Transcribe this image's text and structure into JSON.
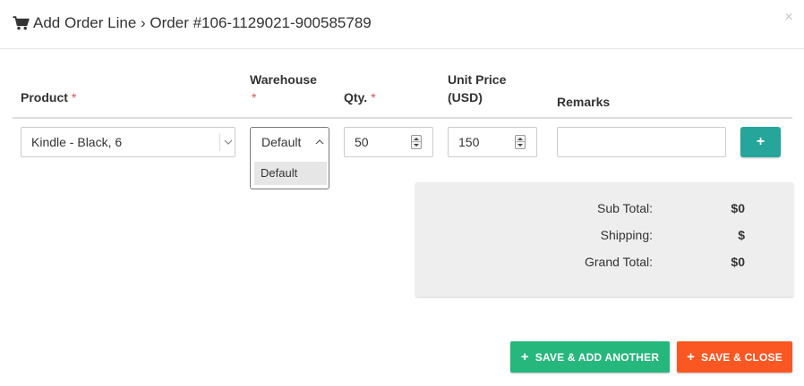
{
  "header": {
    "title": "Add Order Line › Order #106-1129021-900585789",
    "close_label": "×"
  },
  "columns": {
    "product": "Product",
    "warehouse": "Warehouse",
    "qty": "Qty.",
    "unit_price_line1": "Unit Price",
    "unit_price_line2": "(USD)",
    "remarks": "Remarks",
    "required_mark": "*"
  },
  "row": {
    "product_value": "Kindle - Black, 6",
    "warehouse_value": "Default",
    "warehouse_options": [
      "Default"
    ],
    "qty_value": "50",
    "unit_price_value": "150",
    "remarks_value": "",
    "add_button": "+"
  },
  "totals": {
    "sub_total_label": "Sub Total:",
    "sub_total_value": "$0",
    "shipping_label": "Shipping:",
    "shipping_value": "$",
    "grand_total_label": "Grand Total:",
    "grand_total_value": "$0"
  },
  "footer": {
    "save_add_another_label": "SAVE & ADD ANOTHER",
    "save_close_label": "SAVE & CLOSE",
    "plus_glyph": "+"
  },
  "icons": {
    "title_icon": "shopping-cart-icon",
    "close_icon": "close-icon"
  },
  "colors": {
    "required": "#d9534f",
    "add_button": "#26a69a",
    "save_add_another": "#26b77d",
    "save_close": "#fb5722",
    "totals_panel": "#eeeeee"
  }
}
